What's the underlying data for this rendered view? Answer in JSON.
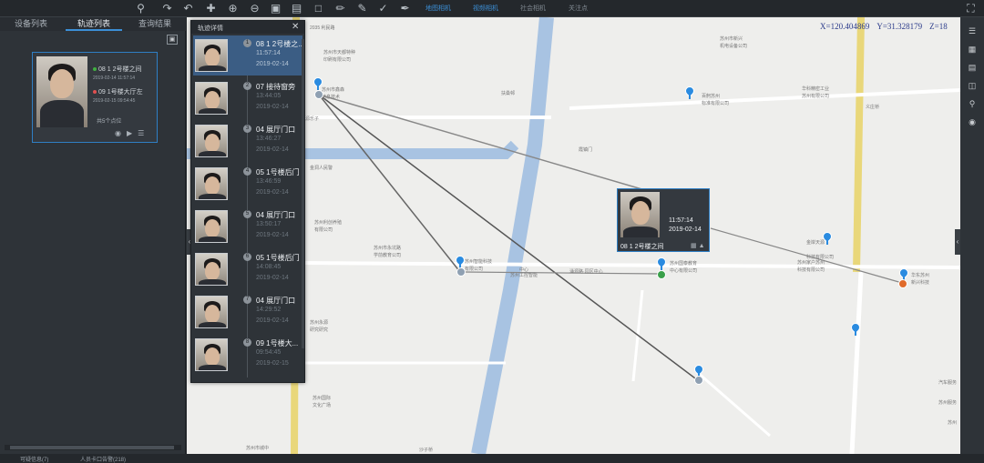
{
  "toolbar": {
    "icons": [
      "search-icon",
      "redo-icon",
      "undo-icon",
      "pan-icon",
      "zoom-in-icon",
      "zoom-out-icon",
      "image-icon",
      "export-icon",
      "crop-icon",
      "ruler-icon",
      "edit-icon",
      "brush-icon",
      "pencil-icon"
    ],
    "links": [
      {
        "label": "地图相机",
        "active": true
      },
      {
        "label": "视频相机",
        "active": true
      },
      {
        "label": "社会相机",
        "active": false
      },
      {
        "label": "关注点",
        "active": false
      }
    ]
  },
  "left": {
    "tabs": [
      "设备列表",
      "轨迹列表",
      "查询结果"
    ],
    "active_tab": 1,
    "card": {
      "line1": "08 1 2号楼之间",
      "line1_sub": "2019-02-14 11:57:14",
      "line2": "09 1号楼大厅左",
      "line2_sub": "2019-02-15 09:54:45",
      "total": "共5个点位",
      "line1_dot": "#40b040",
      "line2_dot": "#e05050"
    }
  },
  "status": {
    "left": "可疑信息(7)",
    "middle": "人员卡口告警(218)"
  },
  "map": {
    "coords": {
      "x": "X=120.404869",
      "y": "Y=31.328179",
      "z": "Z=18"
    },
    "labels": [
      "2035 利民路",
      "苏州市天都特种",
      "印刷有限公司",
      "苏州市鑫森",
      "信息技术",
      "苏州市新兴",
      "机电设备公司",
      "扶桑邨",
      "华科精密工业",
      "苏州有限公司",
      "百舸苏州",
      "标准有限公司",
      "义庄桥",
      "霞镇门",
      "源乐子",
      "金洞人民警",
      "苏州利创养殖",
      "有限公司",
      "苏州市永坑路",
      "学前教育公司",
      "苏州智能科技",
      "有限公司",
      "苏州工控智能",
      "中心",
      "涌源路·园区中心",
      "苏州国泰教育",
      "中心有限公司",
      "金岸天源",
      "科技有限公司",
      "华东苏州",
      "新兴科技",
      "苏州家户苏州",
      "科技有限公司",
      "苏州永源",
      "研究研究",
      "苏州国际",
      "文化广场",
      "苏州市城中",
      "沙子桥",
      "汽车服务",
      "苏州服务",
      "苏州"
    ],
    "popup": {
      "time": "11:57:14",
      "date": "2019-02-14",
      "location": "08 1 2号楼之间"
    },
    "pin_color": "#2a8be0",
    "route_color": "#555555"
  },
  "rightbar": {
    "icons": [
      "fullscreen-icon",
      "layers-icon",
      "grid-icon",
      "map-icon",
      "split-icon",
      "magnify-icon",
      "locate-icon"
    ]
  },
  "detail": {
    "title": "轨迹详情",
    "items": [
      {
        "num": "1",
        "location": "08 1 2号楼之...",
        "time": "11:57:14",
        "date": "2019-02-14",
        "selected": true
      },
      {
        "num": "2",
        "location": "07 接待窗旁",
        "time": "13:44:05",
        "date": "2019-02-14",
        "selected": false
      },
      {
        "num": "3",
        "location": "04 展厅门口",
        "time": "13:46:27",
        "date": "2019-02-14",
        "selected": false
      },
      {
        "num": "4",
        "location": "05 1号楼后门",
        "time": "13:46:59",
        "date": "2019-02-14",
        "selected": false
      },
      {
        "num": "5",
        "location": "04 展厅门口",
        "time": "13:50:17",
        "date": "2019-02-14",
        "selected": false
      },
      {
        "num": "6",
        "location": "05 1号楼后门",
        "time": "14:08:45",
        "date": "2019-02-14",
        "selected": false
      },
      {
        "num": "7",
        "location": "04 展厅门口",
        "time": "14:29:52",
        "date": "2019-02-14",
        "selected": false
      },
      {
        "num": "8",
        "location": "09 1号楼大...",
        "time": "09:54:45",
        "date": "2019-02-15",
        "selected": false
      }
    ]
  }
}
